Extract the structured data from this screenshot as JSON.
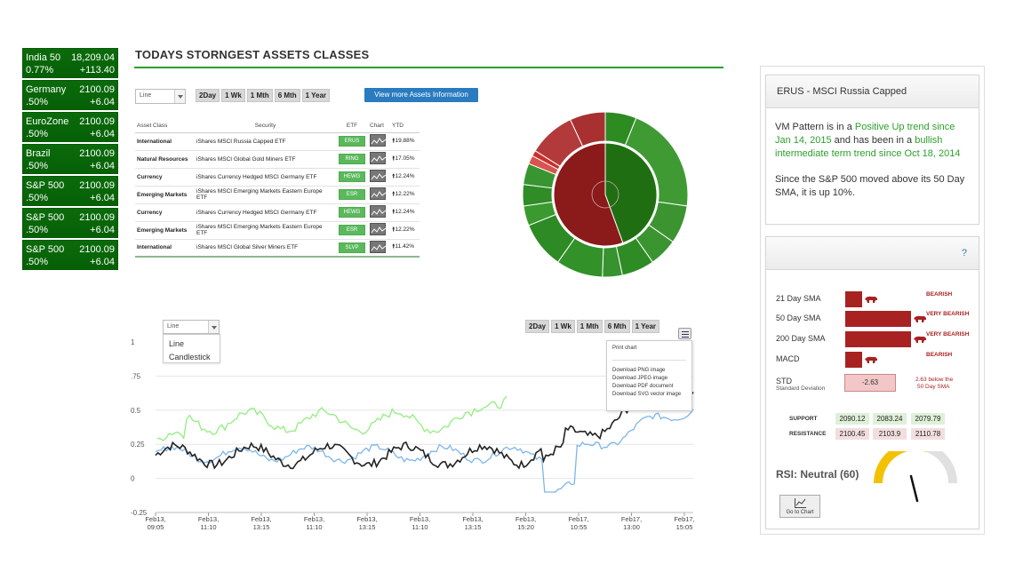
{
  "tickers": [
    {
      "name": "India 50",
      "value": "18,209.04",
      "pct": "0.77%",
      "change": "+113.40"
    },
    {
      "name": "Germany",
      "value": "2100.09",
      "pct": ".50%",
      "change": "+6.04"
    },
    {
      "name": "EuroZone",
      "value": "2100.09",
      "pct": ".50%",
      "change": "+6.04"
    },
    {
      "name": "Brazil",
      "value": "2100.09",
      "pct": ".50%",
      "change": "+6.04"
    },
    {
      "name": "S&P 500",
      "value": "2100.09",
      "pct": ".50%",
      "change": "+6.04"
    },
    {
      "name": "S&P 500",
      "value": "2100.09",
      "pct": ".50%",
      "change": "+6.04"
    },
    {
      "name": "S&P 500",
      "value": "2100.09",
      "pct": ".50%",
      "change": "+6.04"
    }
  ],
  "page_title": "TODAYS STORNGEST ASSETS CLASSES",
  "top_select": {
    "value": "Line"
  },
  "range_buttons": [
    "2Day",
    "1 Wk",
    "1 Mth",
    "6 Mth",
    "1 Year"
  ],
  "info_button": "View more Assets Information",
  "table": {
    "headers": [
      "Asset Class",
      "Security",
      "ETF",
      "Chart",
      "YTD"
    ],
    "rows": [
      {
        "cls": "International",
        "security": "iShares MSCI Russia Capped ETF",
        "etf": "ERUS",
        "ytd": "19.88%"
      },
      {
        "cls": "Natural Resources",
        "security": "iShares MSCI Global Gold Miners ETF",
        "etf": "RING",
        "ytd": "17.05%"
      },
      {
        "cls": "Currency",
        "security": "iShares Currency Hedged MSCI Germany ETF",
        "etf": "HEWG",
        "ytd": "12.24%"
      },
      {
        "cls": "Emerging Markets",
        "security": "iShares MSCI Emerging Markets Eastern Europe ETF",
        "etf": "ESR",
        "ytd": "12.22%"
      },
      {
        "cls": "Currency",
        "security": "iShares Currency Hedged MSCI Germany ETF",
        "etf": "HEWG",
        "ytd": "12.24%"
      },
      {
        "cls": "Emerging Markets",
        "security": "iShares MSCI Emerging Markets Eastern Europe ETF",
        "etf": "ESR",
        "ytd": "12.22%"
      },
      {
        "cls": "International",
        "security": "iShares MSCI Global Silver Miners ETF",
        "etf": "SLVP",
        "ytd": "11.42%"
      }
    ]
  },
  "main_chart": {
    "select_value": "Line",
    "options": [
      "Line",
      "Candlestick"
    ],
    "range_buttons": [
      "2Day",
      "1 Wk",
      "1 Mth",
      "6 Mth",
      "1 Year"
    ],
    "export_items": [
      "Print chart",
      "Download PNG image",
      "Download JPEG image",
      "Download PDF document",
      "Download SVG vector image"
    ],
    "y_ticks": [
      "1",
      ".75",
      "0.5",
      "0.25",
      "0",
      "-0.25"
    ],
    "x_ticks": [
      [
        "Feb13,",
        "09:05"
      ],
      [
        "Feb13,",
        "11:10"
      ],
      [
        "Feb13,",
        "13:15"
      ],
      [
        "Feb13,",
        "11:10"
      ],
      [
        "Feb13,",
        "13:15"
      ],
      [
        "Feb13,",
        "11:10"
      ],
      [
        "Feb13,",
        "13:15"
      ],
      [
        "Feb13,",
        "15:20"
      ],
      [
        "Feb17,",
        "10:55"
      ],
      [
        "Feb17,",
        "13:00"
      ],
      [
        "Feb17,",
        "15:05"
      ]
    ],
    "colors": {
      "black": "#222222",
      "green": "#90ee7e",
      "blue": "#7cb5ec"
    }
  },
  "panel1": {
    "title": "ERUS - MSCI Russia Capped",
    "t1": "VM Pattern is in a ",
    "t2": "Positive Up trend since Jan 14, 2015",
    "t3": " and has been in a ",
    "t4": "bullish intermediate term trend since Oct 18, 2014",
    "p2": "Since the S&P 500 moved above its 50 Day SMA, it is up 10%."
  },
  "panel2": {
    "help": "?",
    "indicators": [
      {
        "label": "21 Day SMA",
        "status": "BEARISH",
        "level": 0.26
      },
      {
        "label": "50 Day SMA",
        "status": "VERY BEARISH",
        "level": 1.0
      },
      {
        "label": "200 Day SMA",
        "status": "VERY BEARISH",
        "level": 1.0
      },
      {
        "label": "MACD",
        "status": "BEARISH",
        "level": 0.26
      }
    ],
    "std_label": "STD",
    "std_sub": "Standard Deviation",
    "std_value": "-2.63",
    "std_note_1": "2.63 below the",
    "std_note_2": "50 Day SMA",
    "support_label": "SUPPORT",
    "resistance_label": "RESISTANCE",
    "support": [
      "2090.12",
      "2083.24",
      "2079.79"
    ],
    "resistance": [
      "2100.45",
      "2103.9",
      "2110.78"
    ],
    "rsi": "RSI: Neutral (60)",
    "rsi_value": 60,
    "goto": "Go to Chart",
    "colors": {
      "bearish": "#a82222",
      "gauge": "#f2c200"
    }
  }
}
